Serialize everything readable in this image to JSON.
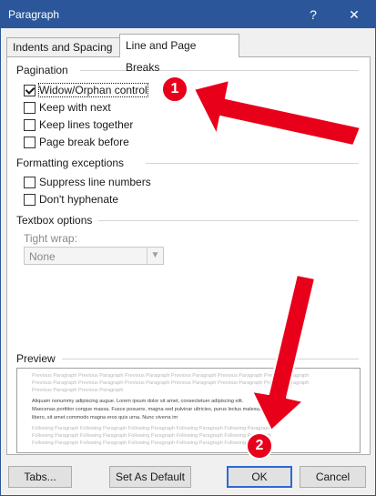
{
  "window": {
    "title": "Paragraph",
    "help_icon": "help-icon",
    "close_icon": "close-icon"
  },
  "tabs": [
    {
      "label": "Indents and Spacing",
      "active": false
    },
    {
      "label": "Line and Page Breaks",
      "active": true
    }
  ],
  "pagination": {
    "heading": "Pagination",
    "options": [
      {
        "label": "Widow/Orphan control",
        "checked": true
      },
      {
        "label": "Keep with next",
        "checked": false
      },
      {
        "label": "Keep lines together",
        "checked": false
      },
      {
        "label": "Page break before",
        "checked": false
      }
    ]
  },
  "formatting_exceptions": {
    "heading": "Formatting exceptions",
    "options": [
      {
        "label": "Suppress line numbers",
        "checked": false
      },
      {
        "label": "Don't hyphenate",
        "checked": false
      }
    ]
  },
  "textbox_options": {
    "heading": "Textbox options",
    "tight_wrap_label": "Tight wrap:",
    "tight_wrap_value": "None"
  },
  "preview": {
    "heading": "Preview",
    "previous_lines": [
      "Previous Paragraph Previous Paragraph Previous Paragraph Previous Paragraph Previous Paragraph Previous Paragraph",
      "Previous Paragraph Previous Paragraph Previous Paragraph Previous Paragraph Previous Paragraph Previous Paragraph",
      "Previous Paragraph Previous Paragraph"
    ],
    "sample_lines": [
      "Aliquam nonummy adipiscing augue. Lorem ipsum dolor sit amet, consectetuer adipiscing elit.",
      "Maecenas porttitor congue massa. Fusce posuere, magna sed pulvinar ultricies, purus lectus malesuada",
      "libero, sit amet commodo magna eros quis urna. Nunc viverra im"
    ],
    "following_lines": [
      "Following Paragraph Following Paragraph Following Paragraph Following Paragraph Following Paragraph",
      "Following Paragraph Following Paragraph Following Paragraph Following Paragraph Following Paragraph",
      "Following Paragraph Following Paragraph Following Paragraph Following Paragraph Following Paragraph"
    ]
  },
  "buttons": {
    "tabs": "Tabs...",
    "set_default": "Set As Default",
    "ok": "OK",
    "cancel": "Cancel"
  },
  "annotations": {
    "badge_1": "1",
    "badge_2": "2",
    "color": "#e8001b"
  },
  "colors": {
    "accent": "#2b579a",
    "default_button_border": "#2b6ad6"
  }
}
